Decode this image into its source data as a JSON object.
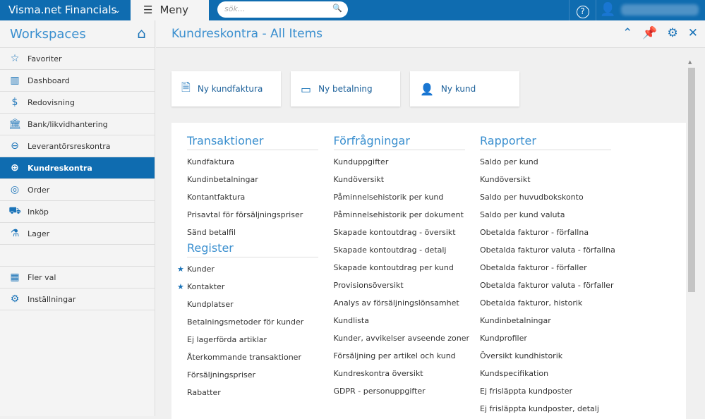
{
  "topbar": {
    "brand": "Visma.net Financials",
    "menu": "Meny",
    "search_placeholder": "sök..."
  },
  "sidebar": {
    "title": "Workspaces",
    "items": [
      {
        "label": "Favoriter",
        "icon": "☆"
      },
      {
        "label": "Dashboard",
        "icon": "▥"
      },
      {
        "label": "Redovisning",
        "icon": "$"
      },
      {
        "label": "Bank/likvidhantering",
        "icon": "🏛"
      },
      {
        "label": "Leverantörsreskontra",
        "icon": "⊖"
      },
      {
        "label": "Kundreskontra",
        "icon": "⊕"
      },
      {
        "label": "Order",
        "icon": "◎"
      },
      {
        "label": "Inköp",
        "icon": "⛟"
      },
      {
        "label": "Lager",
        "icon": "⚗"
      }
    ],
    "bottom": [
      {
        "label": "Fler val",
        "icon": "▦"
      },
      {
        "label": "Inställningar",
        "icon": "⚙"
      }
    ]
  },
  "header": {
    "title": "Kundreskontra - All Items"
  },
  "quick": [
    {
      "label": "Ny kundfaktura",
      "icon": "🗎"
    },
    {
      "label": "Ny betalning",
      "icon": "▭"
    },
    {
      "label": "Ny kund",
      "icon": "👤"
    }
  ],
  "columns": [
    {
      "sections": [
        {
          "title": "Transaktioner",
          "items": [
            {
              "label": "Kundfaktura"
            },
            {
              "label": "Kundinbetalningar"
            },
            {
              "label": "Kontantfaktura"
            },
            {
              "label": "Prisavtal för försäljningspriser"
            },
            {
              "label": "Sänd betalfil"
            }
          ]
        },
        {
          "title": "Register",
          "items": [
            {
              "label": "Kunder",
              "star": true
            },
            {
              "label": "Kontakter",
              "star": true
            },
            {
              "label": "Kundplatser"
            },
            {
              "label": "Betalningsmetoder för kunder"
            },
            {
              "label": "Ej lagerförda artiklar"
            },
            {
              "label": "Återkommande transaktioner"
            },
            {
              "label": "Försäljningspriser"
            },
            {
              "label": "Rabatter"
            }
          ]
        }
      ]
    },
    {
      "sections": [
        {
          "title": "Förfrågningar",
          "items": [
            {
              "label": "Kunduppgifter"
            },
            {
              "label": "Kundöversikt"
            },
            {
              "label": "Påminnelsehistorik per kund"
            },
            {
              "label": "Påminnelsehistorik per dokument"
            },
            {
              "label": "Skapade kontoutdrag - översikt"
            },
            {
              "label": "Skapade kontoutdrag - detalj"
            },
            {
              "label": "Skapade kontoutdrag per kund"
            },
            {
              "label": "Provisionsöversikt"
            },
            {
              "label": "Analys av försäljningslönsamhet"
            },
            {
              "label": "Kundlista"
            },
            {
              "label": "Kunder, avvikelser avseende zoner"
            },
            {
              "label": "Försäljning per artikel och kund"
            },
            {
              "label": "Kundreskontra översikt"
            },
            {
              "label": "GDPR - personuppgifter"
            }
          ]
        }
      ]
    },
    {
      "sections": [
        {
          "title": "Rapporter",
          "items": [
            {
              "label": "Saldo per kund"
            },
            {
              "label": "Kundöversikt"
            },
            {
              "label": "Saldo per huvudbokskonto"
            },
            {
              "label": "Saldo per kund valuta"
            },
            {
              "label": "Obetalda fakturor - förfallna"
            },
            {
              "label": "Obetalda fakturor valuta - förfallna"
            },
            {
              "label": "Obetalda fakturor - förfaller"
            },
            {
              "label": "Obetalda fakturor valuta - förfaller"
            },
            {
              "label": "Obetalda fakturor, historik"
            },
            {
              "label": "Kundinbetalningar"
            },
            {
              "label": "Kundprofiler"
            },
            {
              "label": "Översikt kundhistorik"
            },
            {
              "label": "Kundspecifikation"
            },
            {
              "label": "Ej frisläppta kundposter"
            },
            {
              "label": "Ej frisläppta kundposter, detalj"
            }
          ]
        }
      ]
    }
  ]
}
